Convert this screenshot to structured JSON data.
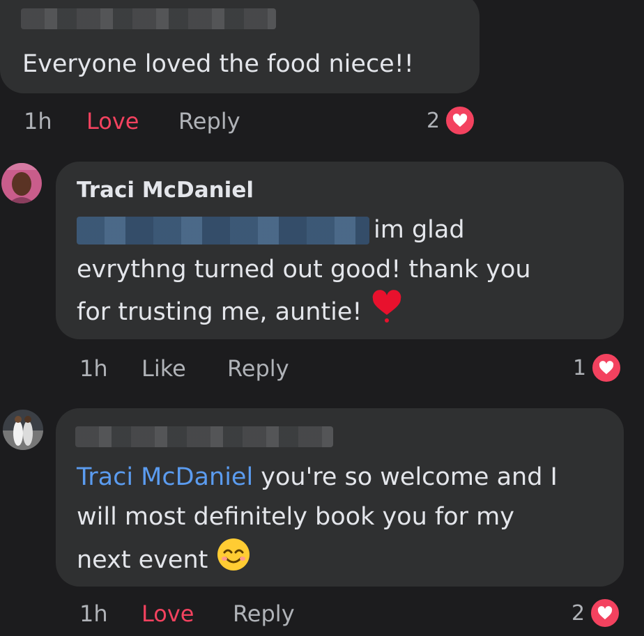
{
  "comments": [
    {
      "text": "Everyone loved the food niece!!",
      "time": "1h",
      "action1": "Love",
      "action2": "Reply",
      "reaction_count": "2"
    },
    {
      "author": "Traci McDaniel",
      "text_line1": "im glad",
      "text_line2": "evrythng turned out good! thank you",
      "text_line3": "for trusting me, auntie!",
      "time": "1h",
      "action1": "Like",
      "action2": "Reply",
      "reaction_count": "1"
    },
    {
      "mention": "Traci McDaniel",
      "text_line1": " you're so welcome and I",
      "text_line2": "will most definitely book you for my",
      "text_line3": "next event",
      "time": "1h",
      "action1": "Love",
      "action2": "Reply",
      "reaction_count": "2"
    }
  ],
  "colors": {
    "background": "#1c1c1e",
    "bubble": "#2f3031",
    "love": "#f3425f",
    "mention": "#5b9cf0"
  },
  "icons": [
    "heart-reaction-icon",
    "red-heart-emoji-icon",
    "smiling-face-emoji-icon"
  ]
}
